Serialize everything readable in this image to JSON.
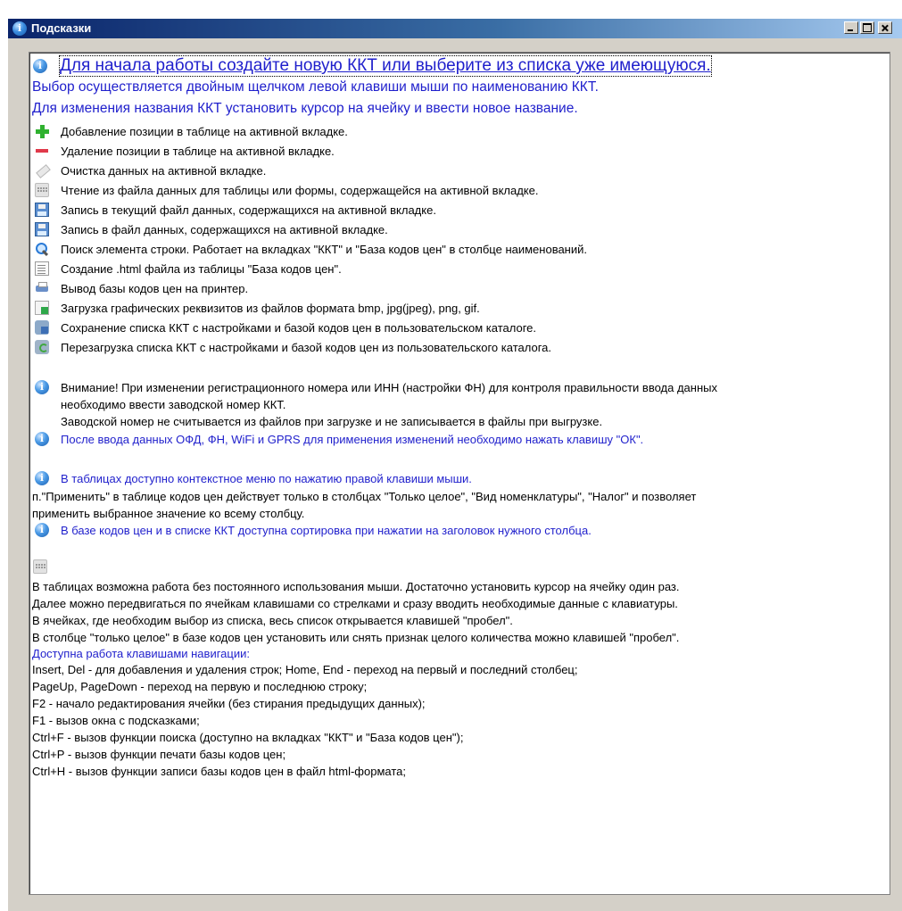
{
  "window": {
    "title": "Подсказки"
  },
  "content": {
    "headline": "Для начала работы создайте новую ККТ или выберите из списка уже имеющуюся.",
    "intro_1": "Выбор осуществляется двойным щелчком левой клавиши мыши по наименованию ККТ.",
    "intro_2": "Для изменения названия ККТ установить курсор на ячейку и ввести новое название.",
    "toolbar_help": [
      {
        "icon": "add-icon",
        "text": "Добавление позиции в таблице на активной вкладке."
      },
      {
        "icon": "remove-icon",
        "text": "Удаление позиции в таблице на активной вкладке."
      },
      {
        "icon": "eraser-icon",
        "text": "Очистка данных на активной вкладке."
      },
      {
        "icon": "open-file-icon",
        "text": "Чтение из файла данных для таблицы или формы, содержащейся на активной вкладке."
      },
      {
        "icon": "save-icon",
        "text": "Запись в текущий файл данных, содержащихся на активной вкладке."
      },
      {
        "icon": "save-as-icon",
        "text": "Запись в файл данных, содержащихся на активной вкладке."
      },
      {
        "icon": "search-icon",
        "text": "Поиск элемента строки. Работает на вкладках \"ККТ\" и \"База кодов цен\" в столбце наименований."
      },
      {
        "icon": "html-file-icon",
        "text": "Создание .html файла из таблицы \"База кодов цен\"."
      },
      {
        "icon": "printer-icon",
        "text": "Вывод базы кодов цен на принтер."
      },
      {
        "icon": "image-icon",
        "text": "Загрузка графических реквизитов из файлов формата bmp, jpg(jpeg), png, gif."
      },
      {
        "icon": "database-save-icon",
        "text": "Сохранение списка ККТ с настройками и базой кодов цен в пользовательском каталоге."
      },
      {
        "icon": "database-reload-icon",
        "text": "Перезагрузка списка ККТ с настройками и базой кодов цен из пользовательского каталога."
      }
    ],
    "warning_1": "Внимание! При изменении регистрационного номера или ИНН (настройки ФН)  для контроля правильности ввода данных",
    "warning_2": "необходимо ввести заводской номер ККТ.",
    "warning_3": "Заводской номер не считывается из файлов при загрузке и не записывается в файлы при выгрузке.",
    "ofd_note": "После ввода данных ОФД, ФН, WiFi и GPRS для применения изменений необходимо нажать клавишу \"ОК\".",
    "context_menu_note": "В таблицах доступно контекстное меню по нажатию правой клавиши мыши.",
    "apply_note_1": "п.\"Применить\" в таблице кодов цен действует только в столбцах \"Только целое\", \"Вид номенклатуры\", \"Налог\" и позволяет",
    "apply_note_2": "применить выбранное значение ко всему столбцу.",
    "sort_note": "В базе кодов цен и в списке ККТ доступна сортировка при нажатии на заголовок нужного столбца.",
    "keyboard_lines": [
      "В таблицах возможна работа без постоянного использования мыши. Достаточно установить курсор на ячейку один раз.",
      "Далее можно передвигаться по ячейкам клавишами со стрелками и сразу вводить необходимые данные с клавиатуры.",
      "В ячейках, где необходим выбор из списка, весь список открывается клавишей \"пробел\".",
      "В столбце \"только целое\" в базе кодов цен установить или снять признак целого количества можно клавишей \"пробел\"."
    ],
    "nav_title": "Доступна работа клавишами навигации:",
    "nav_lines": [
      "Insert, Del - для добавления и удаления строк; Home, End - переход на первый и последний столбец;",
      "PageUp, PageDown - переход на первую и последнюю строку;",
      "F2 - начало редактирования ячейки (без стирания предыдущих данных);",
      "F1 - вызов окна с подсказками;",
      "Ctrl+F - вызов функции поиска (доступно на вкладках \"ККТ\" и \"База кодов цен\");",
      "Ctrl+P - вызов функции печати базы кодов цен;",
      "Ctrl+H - вызов функции записи базы кодов цен в файл html-формата;"
    ]
  }
}
